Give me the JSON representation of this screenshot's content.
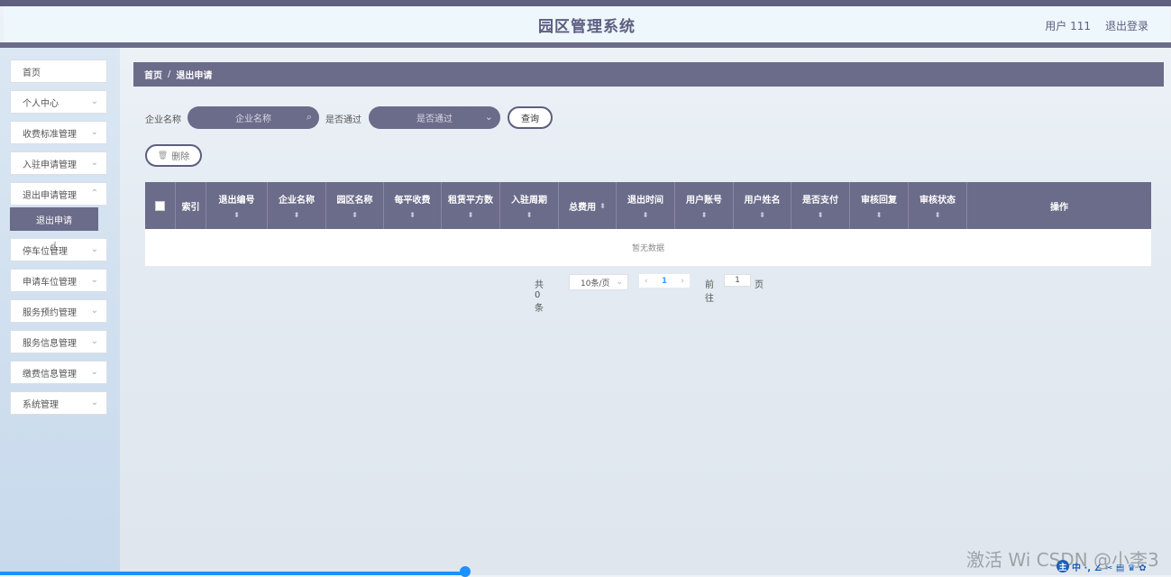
{
  "header": {
    "title": "园区管理系统",
    "user_label": "用户 111",
    "logout_label": "退出登录"
  },
  "sidebar": {
    "items": [
      {
        "label": "首页"
      },
      {
        "label": "个人中心"
      },
      {
        "label": "收费标准管理"
      },
      {
        "label": "入驻申请管理"
      },
      {
        "label": "退出申请管理"
      },
      {
        "label": "停车位管理"
      },
      {
        "label": "申请车位管理"
      },
      {
        "label": "服务预约管理"
      },
      {
        "label": "服务信息管理"
      },
      {
        "label": "缴费信息管理"
      },
      {
        "label": "系统管理"
      }
    ],
    "active_sub": "退出申请"
  },
  "breadcrumb": {
    "home": "首页",
    "separator": "/",
    "current": "退出申请"
  },
  "search": {
    "company_label": "企业名称",
    "company_placeholder": "企业名称",
    "approved_label": "是否通过",
    "approved_placeholder": "是否通过",
    "query_button": "查询"
  },
  "toolbar": {
    "delete_button": "删除"
  },
  "table": {
    "columns": [
      {
        "label": "索引"
      },
      {
        "label": "退出编号"
      },
      {
        "label": "企业名称"
      },
      {
        "label": "园区名称"
      },
      {
        "label": "每平收费"
      },
      {
        "label": "租赁平方数"
      },
      {
        "label": "入驻周期"
      },
      {
        "label": "总费用"
      },
      {
        "label": "退出时间"
      },
      {
        "label": "用户账号"
      },
      {
        "label": "用户姓名"
      },
      {
        "label": "是否支付"
      },
      {
        "label": "审核回复"
      },
      {
        "label": "审核状态"
      },
      {
        "label": "操作"
      }
    ],
    "empty_text": "暂无数据"
  },
  "pagination": {
    "total": "共 0 条",
    "page_size": "10条/页",
    "current_page": "1",
    "goto_label": "前往",
    "goto_value": "1",
    "page_suffix": "页"
  },
  "overlay": {
    "watermark": "激活 Wi CSDN @小李3",
    "ime_badge": "主",
    "ime_text": "中 ·, ∠ ✂ ▤ ♛ ✿"
  },
  "colors": {
    "primary": "#6b6b8a",
    "header_bg": "#eef7fc"
  }
}
